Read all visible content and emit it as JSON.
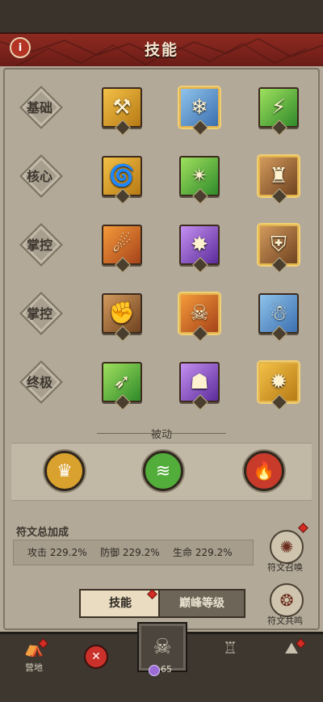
{
  "header": {
    "title": "技能",
    "info_icon": "info-icon"
  },
  "rows": [
    {
      "label": "基础",
      "skills": [
        {
          "icon": "hammer-strike-icon",
          "color": "gold",
          "selected": false
        },
        {
          "icon": "ice-shards-icon",
          "color": "blue",
          "selected": true
        },
        {
          "icon": "green-slash-icon",
          "color": "green",
          "selected": false
        }
      ]
    },
    {
      "label": "核心",
      "skills": [
        {
          "icon": "whirlwind-icon",
          "color": "gold",
          "selected": false
        },
        {
          "icon": "leaf-burst-icon",
          "color": "green",
          "selected": false
        },
        {
          "icon": "totem-icon",
          "color": "brown",
          "selected": true
        }
      ]
    },
    {
      "label": "掌控",
      "skills": [
        {
          "icon": "fire-comet-icon",
          "color": "orange",
          "selected": false
        },
        {
          "icon": "shadow-spikes-icon",
          "color": "purple",
          "selected": false
        },
        {
          "icon": "earth-shield-icon",
          "color": "brown",
          "selected": true
        }
      ]
    },
    {
      "label": "掌控",
      "skills": [
        {
          "icon": "beast-roar-icon",
          "color": "brown",
          "selected": false
        },
        {
          "icon": "wolf-howl-icon",
          "color": "orange",
          "selected": true
        },
        {
          "icon": "frost-golem-icon",
          "color": "blue",
          "selected": false
        }
      ]
    },
    {
      "label": "终极",
      "skills": [
        {
          "icon": "wind-blade-icon",
          "color": "green",
          "selected": false
        },
        {
          "icon": "demon-mask-icon",
          "color": "purple",
          "selected": false
        },
        {
          "icon": "golden-star-icon",
          "color": "gold",
          "selected": true
        }
      ]
    }
  ],
  "passive": {
    "title": "被动",
    "items": [
      {
        "icon": "helmet-icon",
        "color": "gold"
      },
      {
        "icon": "wind-swirl-icon",
        "color": "green"
      },
      {
        "icon": "flame-face-icon",
        "color": "red"
      }
    ]
  },
  "bonus": {
    "title": "符文总加成",
    "stats": [
      {
        "label": "攻击",
        "value": "229.2%"
      },
      {
        "label": "防御",
        "value": "229.2%"
      },
      {
        "label": "生命",
        "value": "229.2%"
      }
    ]
  },
  "side_buttons": {
    "summon_label": "符文召唤",
    "resonance_label": "符文共鸣"
  },
  "tabs": {
    "skill": "技能",
    "peak": "巅峰等级"
  },
  "bottom_nav": {
    "camp_label": "营地",
    "gem_count": "65"
  },
  "colors": {
    "gold": "#d9a12d",
    "blue": "#5b8fd0",
    "green": "#52ad3a",
    "orange": "#d56d2a",
    "purple": "#8a55c8",
    "brown": "#9c6538",
    "red": "#c83a2a"
  }
}
